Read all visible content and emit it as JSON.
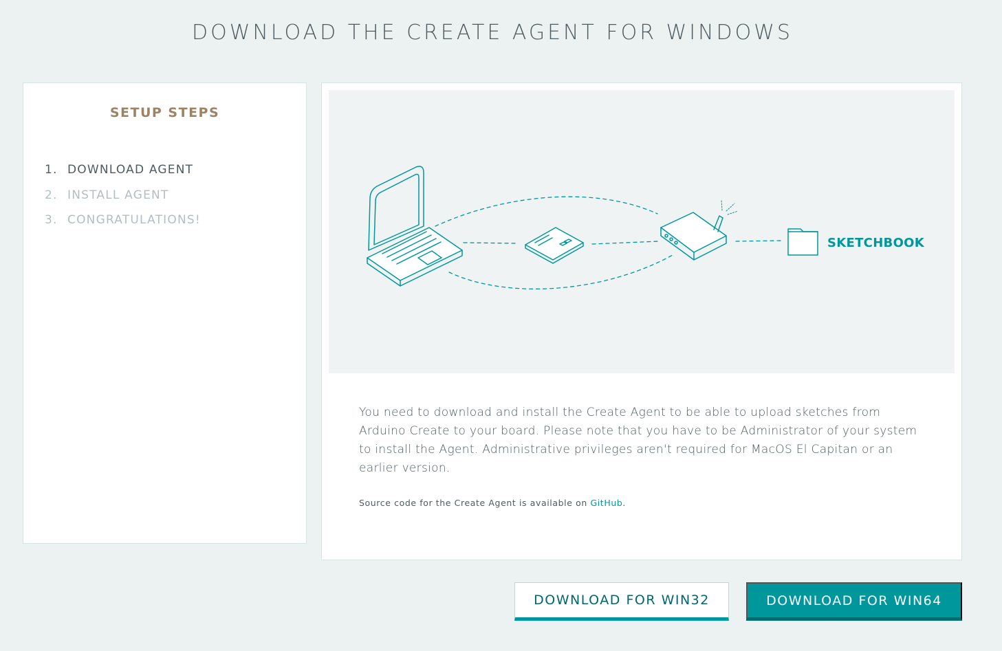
{
  "page": {
    "title": "DOWNLOAD THE CREATE AGENT FOR WINDOWS"
  },
  "setup": {
    "title": "SETUP STEPS",
    "steps": [
      {
        "number": "1.",
        "label": "DOWNLOAD AGENT",
        "active": true
      },
      {
        "number": "2.",
        "label": "INSTALL AGENT",
        "active": false
      },
      {
        "number": "3.",
        "label": "CONGRATULATIONS!",
        "active": false
      }
    ]
  },
  "illustration": {
    "icons": [
      "laptop-icon",
      "arduino-board-icon",
      "router-icon",
      "folder-icon"
    ],
    "sketchbook_label": "SKETCHBOOK"
  },
  "main": {
    "description": "You need to download and install the Create Agent to be able to upload sketches from Arduino Create to your board. Please note that you have to be Administrator of your system to install the Agent. Administrative privileges aren't required for MacOS El Capitan or an earlier version.",
    "source_prefix": "Source code for the Create Agent is available on ",
    "source_link": "GitHub",
    "source_suffix": "."
  },
  "buttons": {
    "win32": "DOWNLOAD FOR WIN32",
    "win64": "DOWNLOAD FOR WIN64"
  },
  "colors": {
    "accent": "#00979c",
    "accent_dark": "#006d70",
    "steps_title": "#9b8364",
    "background": "#ecf1f1",
    "text": "#4e5b61",
    "muted": "#b4bec2"
  }
}
